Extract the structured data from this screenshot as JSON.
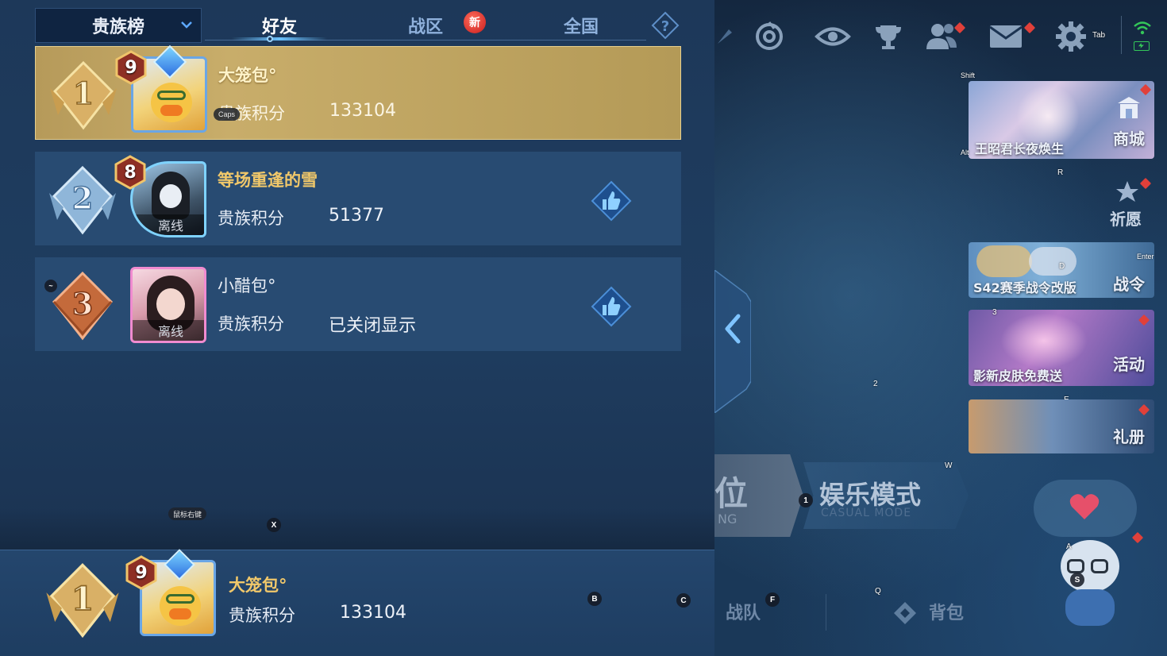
{
  "tabs": {
    "select_label": "贵族榜",
    "friends": "好友",
    "zone": "战区",
    "zone_new_badge": "新",
    "national": "全国"
  },
  "leaderboard": [
    {
      "rank": "1",
      "level": "9",
      "name": "大笼包°",
      "score_label": "贵族积分",
      "score": "133104",
      "status": ""
    },
    {
      "rank": "2",
      "level": "8",
      "name": "等场重逢的雪",
      "score_label": "贵族积分",
      "score": "51377",
      "status": "离线"
    },
    {
      "rank": "3",
      "level": "",
      "name": "小醋包°",
      "score_label": "贵族积分",
      "score": "已关闭显示",
      "status": "离线"
    }
  ],
  "me": {
    "rank": "1",
    "level": "9",
    "name": "大笼包°",
    "score_label": "贵族积分",
    "score": "133104"
  },
  "lobby": {
    "shop_label": "商城",
    "shop_promo": "王昭君长夜焕生",
    "wish_label": "祈愿",
    "battlepass_label": "战令",
    "battlepass_promo": "S42赛季战令改版",
    "events_label": "活动",
    "events_promo": "影新皮肤免费送",
    "giftbook_label": "礼册",
    "mode_partial": "位",
    "mode_partial_en": "NG",
    "casual_mode": "娱乐模式",
    "casual_mode_en": "CASUAL MODE",
    "team_label": "战队",
    "bag_label": "背包"
  },
  "key_hints": {
    "tab": "Tab",
    "shift": "Shift",
    "alt": "Alt",
    "caps": "Caps",
    "r": "R",
    "enter": "Enter",
    "d": "D",
    "three": "3",
    "two": "2",
    "e": "E",
    "w": "W",
    "one": "1",
    "a": "A",
    "s": "S",
    "q": "Q",
    "f": "F",
    "b": "B",
    "c": "C",
    "x": "X",
    "tilde": "~",
    "mouse_right": "鼠标右键"
  },
  "colors": {
    "panel_bg": "#1f3d60",
    "row_bg": "#284b72",
    "me_row_gold": "#c8ad6a",
    "name_gold": "#f1c86a",
    "accent_blue": "#6cc3ff",
    "badge_red": "#d9322b"
  }
}
